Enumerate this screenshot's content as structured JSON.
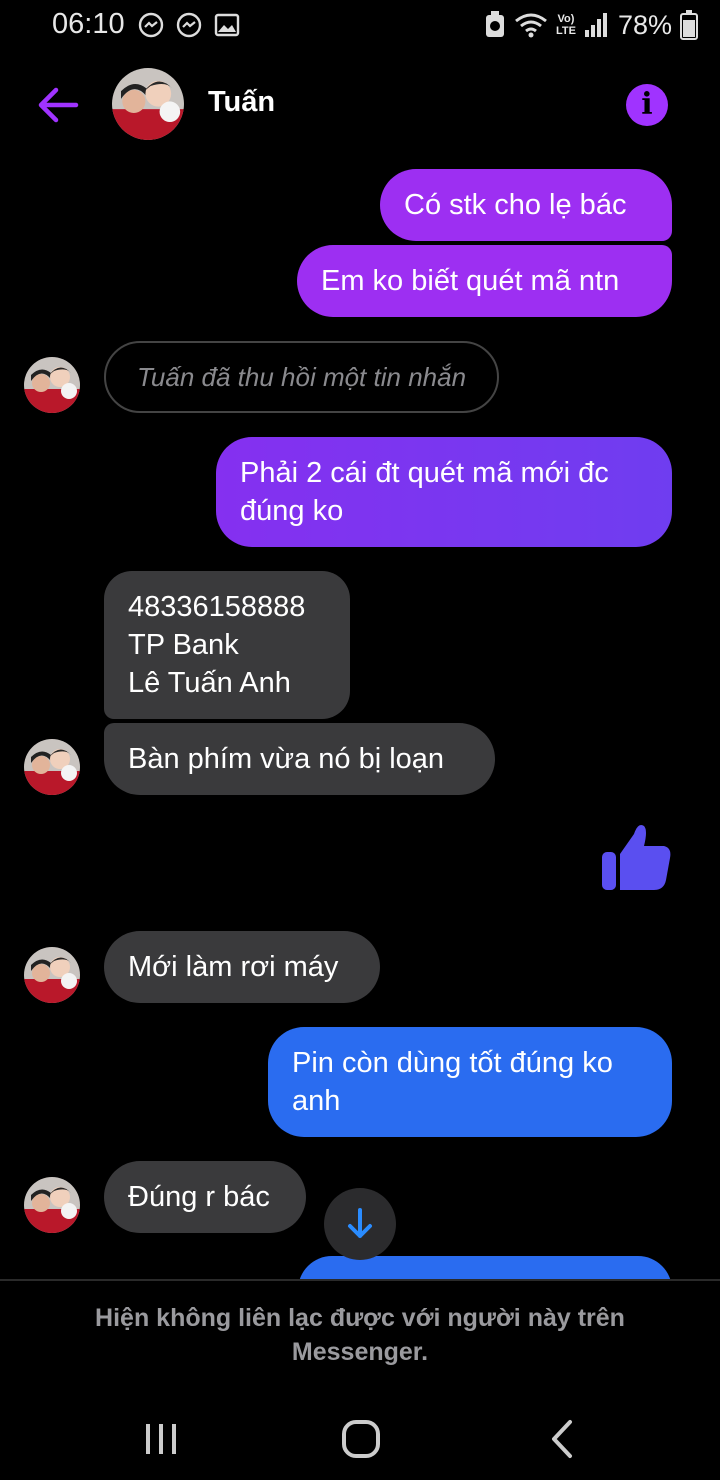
{
  "status_bar": {
    "time": "06:10",
    "battery": "78%",
    "network": "LTE",
    "volte": "Vo)"
  },
  "header": {
    "contact_name": "Tuấn"
  },
  "messages": [
    {
      "text": "Có stk cho lẹ bác"
    },
    {
      "text": "Em ko biết quét mã ntn"
    },
    {
      "text": "Tuấn đã thu hồi một tin nhắn"
    },
    {
      "text": "Phải 2 cái đt quét mã mới đc\nđúng ko"
    },
    {
      "text": "48336158888\nTP Bank\nLê Tuấn Anh"
    },
    {
      "text": "Bàn phím vừa nó bị loạn"
    },
    {
      "text": "Mới làm rơi máy"
    },
    {
      "text": "Pin còn dùng tốt đúng ko\nanh"
    },
    {
      "text": "Đúng r bác"
    }
  ],
  "footer": {
    "notice": "Hiện không liên lạc được với người này trên Messenger."
  },
  "colors": {
    "accent": "#a033ff",
    "outgoing_purple": "#9d2ff2",
    "outgoing_blue": "#2a6cf0",
    "incoming": "#3a3a3c",
    "like": "#5a4ff0"
  },
  "icons": [
    "messenger-icon",
    "gallery-icon",
    "wifi-icon",
    "signal-icon",
    "battery-icon",
    "back-arrow-icon",
    "info-icon",
    "thumbs-up-icon",
    "arrow-down-icon"
  ]
}
